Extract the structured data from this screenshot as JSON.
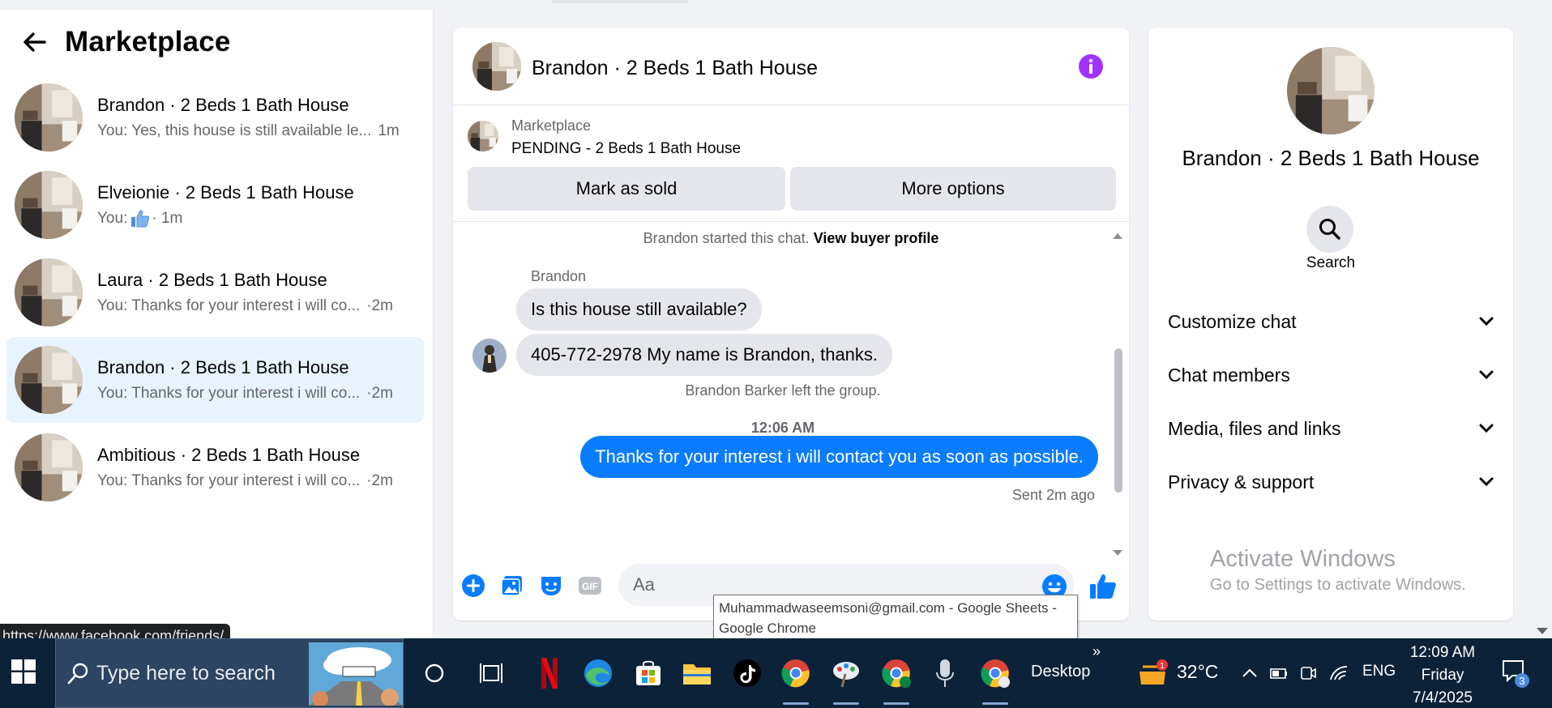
{
  "marketplace": {
    "title": "Marketplace",
    "conversations": [
      {
        "name": "Brandon · 2 Beds 1 Bath House",
        "preview": "You: Yes, this house is still available le...",
        "time": "1m"
      },
      {
        "name": "Elveionie · 2 Beds 1 Bath House",
        "preview_prefix": "You:",
        "preview": "",
        "time": "· 1m",
        "has_like": true
      },
      {
        "name": "Laura · 2 Beds 1 Bath House",
        "preview": "You: Thanks for your interest i will co...",
        "time": "·2m"
      },
      {
        "name": "Brandon · 2 Beds 1 Bath House",
        "preview": "You: Thanks for your interest i will co...",
        "time": "·2m",
        "active": true
      },
      {
        "name": "Ambitious · 2 Beds 1 Bath House",
        "preview": "You: Thanks for your interest i will co...",
        "time": "·2m"
      }
    ]
  },
  "url_tooltip": "https://www.facebook.com/friends/",
  "chat": {
    "title": "Brandon · 2 Beds 1 Bath House",
    "listing": {
      "label": "Marketplace",
      "status": "PENDING - 2 Beds 1 Bath House",
      "mark_sold": "Mark as sold",
      "more_options": "More options"
    },
    "started_text": "Brandon started this chat.",
    "view_buyer_profile": "View buyer profile",
    "sender_name": "Brandon",
    "messages": [
      {
        "text": "Is this house still available?"
      },
      {
        "text": "405-772-2978 My name is Brandon, thanks."
      }
    ],
    "system_message": "Brandon Barker left the group.",
    "timestamp": "12:06 AM",
    "my_message": "Thanks for your interest i will contact you as soon as possible.",
    "sent_status": "Sent 2m ago",
    "input_placeholder": "Aa"
  },
  "chrome_tooltip": {
    "line1": "Muhammadwaseemsoni@gmail.com - Google Sheets -",
    "line2": "Google Chrome"
  },
  "details": {
    "title": "Brandon · 2 Beds 1 Bath House",
    "search_label": "Search",
    "sections": [
      "Customize chat",
      "Chat members",
      "Media, files and links",
      "Privacy & support"
    ],
    "activate_title": "Activate Windows",
    "activate_sub": "Go to Settings to activate Windows."
  },
  "taskbar": {
    "search_placeholder": "Type here to search",
    "desktop_label": "Desktop",
    "weather_badge": "1",
    "temperature": "32°C",
    "language": "ENG",
    "time": "12:09 AM",
    "day": "Friday",
    "date": "7/4/2025",
    "notification_count": "3"
  },
  "colors": {
    "messenger_blue": "#0a7cff",
    "active_row": "#e7f3ff",
    "info_purple": "#a033ff",
    "taskbar": "#0c2239"
  }
}
